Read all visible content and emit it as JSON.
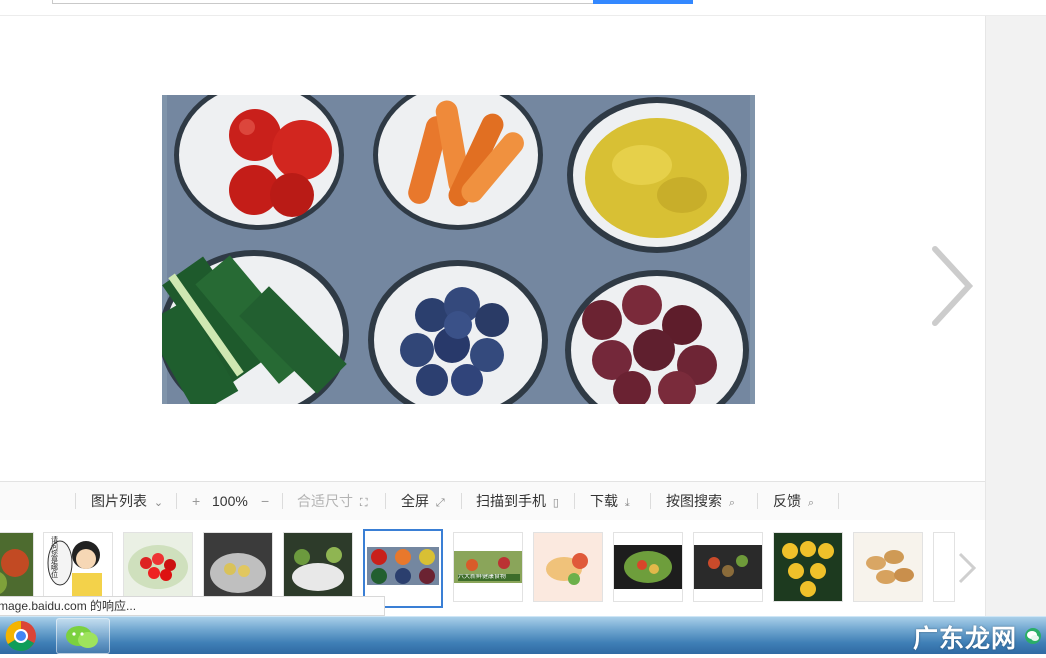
{
  "toolbar": {
    "list_label": "图片列表",
    "zoom_in": "+",
    "zoom": "100%",
    "zoom_out": "−",
    "fit_label": "合适尺寸",
    "fullscreen_label": "全屏",
    "scan_label": "扫描到手机",
    "download_label": "下载",
    "search_by_image_label": "按图搜索",
    "feedback_label": "反馈"
  },
  "status_text": "mage.baidu.com 的响应...",
  "watermark": "广东龙网",
  "thumb_0_text": "请问您是哪位",
  "thumb_6_text": "六大新鲜健康食物",
  "icons": [
    "chevron-down-circle-icon",
    "fit-size-icon",
    "fullscreen-icon",
    "phone-icon",
    "download-icon",
    "image-search-icon",
    "feedback-icon",
    "next-arrow-icon",
    "chrome-icon",
    "wechat-icon"
  ],
  "colors": {
    "accent": "#3388ff",
    "active_thumb_border": "#3a7fd5",
    "taskbar": "#3f7fb6"
  }
}
